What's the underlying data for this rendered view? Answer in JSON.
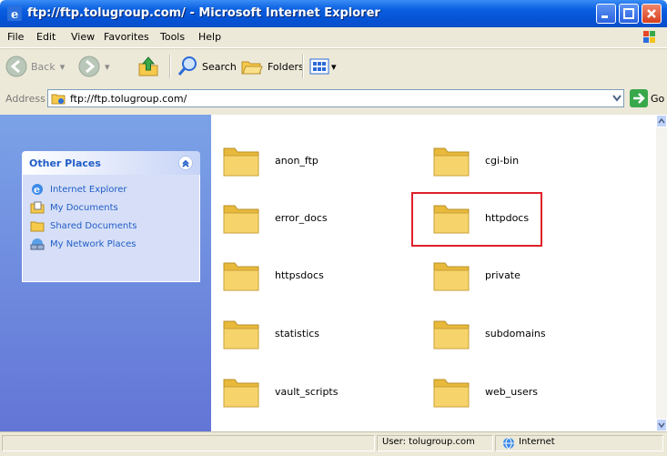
{
  "window": {
    "title": "ftp://ftp.tolugroup.com/ - Microsoft Internet Explorer"
  },
  "menu": [
    "File",
    "Edit",
    "View",
    "Favorites",
    "Tools",
    "Help"
  ],
  "toolbar": {
    "back_label": "Back",
    "search_label": "Search",
    "folders_label": "Folders"
  },
  "address": {
    "label": "Address",
    "value": "ftp://ftp.tolugroup.com/",
    "go_label": "Go"
  },
  "taskpane": {
    "heading": "Other Places",
    "items": [
      {
        "label": "Internet Explorer",
        "icon": "ie-icon"
      },
      {
        "label": "My Documents",
        "icon": "my-documents-icon"
      },
      {
        "label": "Shared Documents",
        "icon": "shared-folder-icon"
      },
      {
        "label": "My Network Places",
        "icon": "network-places-icon"
      }
    ]
  },
  "folders": [
    {
      "name": "anon_ftp"
    },
    {
      "name": "cgi-bin"
    },
    {
      "name": "error_docs"
    },
    {
      "name": "httpdocs",
      "highlighted": true
    },
    {
      "name": "httpsdocs"
    },
    {
      "name": "private"
    },
    {
      "name": "statistics"
    },
    {
      "name": "subdomains"
    },
    {
      "name": "vault_scripts"
    },
    {
      "name": "web_users"
    }
  ],
  "status": {
    "user": "User: tolugroup.com",
    "zone": "Internet"
  },
  "colors": {
    "titlebar": "#0553d6",
    "taskpane_link": "#215dc6",
    "highlight_box": "#e0202a",
    "folder": "#f6d46b"
  }
}
